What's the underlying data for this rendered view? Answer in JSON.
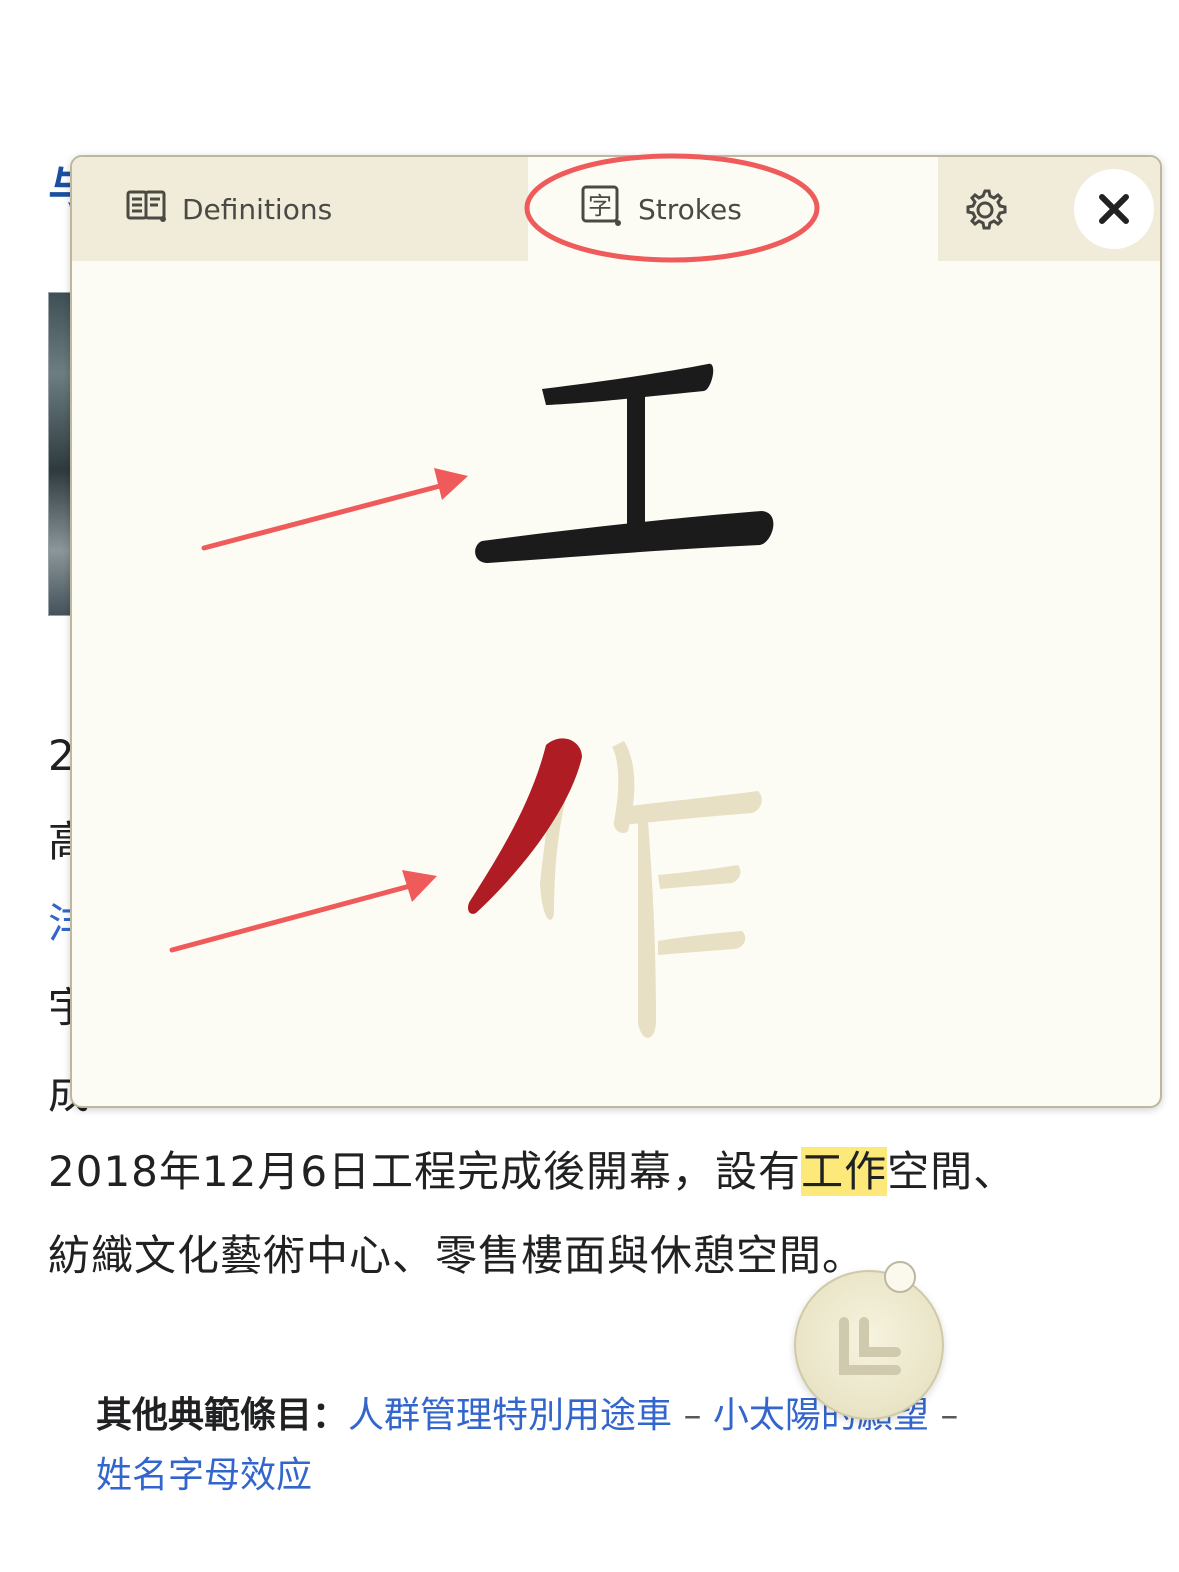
{
  "article": {
    "heading_fragment": "与",
    "frag_2": "2",
    "frag_gao": "高",
    "frag_link": "沣",
    "frag_yu": "宇",
    "frag_cheng": "成",
    "line1": {
      "before": "2018年12月6日工程完成後開幕，設有",
      "highlight": "工作",
      "after": "空間、"
    },
    "line2": "紡織文化藝術中心、零售樓面與休憩空間。",
    "other_label": "其他典範條目：",
    "other_links": [
      "人群管理特別用途車",
      "小太陽的願望",
      "姓名字母效应"
    ],
    "separator": " – "
  },
  "popup": {
    "tabs": {
      "definitions": {
        "label": "Definitions",
        "icon": "book-icon"
      },
      "strokes": {
        "label": "Strokes",
        "icon": "character-card-icon",
        "icon_glyph": "字",
        "active": true
      }
    },
    "settings_icon": "gear-icon",
    "close_icon": "close-icon",
    "characters": [
      {
        "char": "工",
        "state": "complete",
        "color": "#1b1b1b"
      },
      {
        "char": "作",
        "state": "animating",
        "strokes_drawn": 1,
        "color_drawn": "#b01c24",
        "color_pending": "#e7e0c4"
      }
    ]
  },
  "floating_button": {
    "icon": "reader-icon"
  },
  "annotations": {
    "color": "#ef5b5b",
    "marks": [
      "strokes-tab-circle",
      "arrow-to-gong",
      "arrow-to-zuo"
    ]
  }
}
